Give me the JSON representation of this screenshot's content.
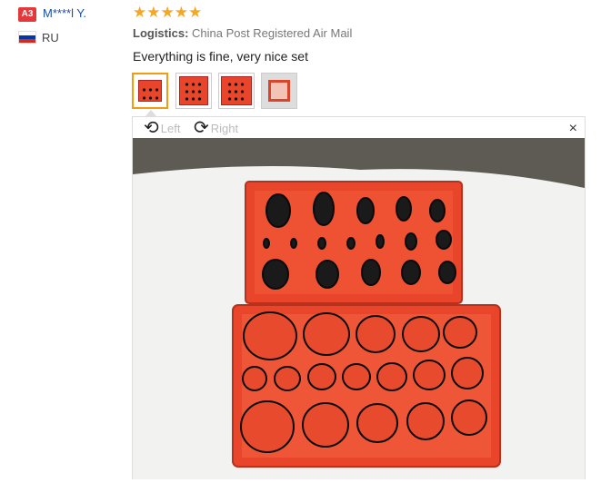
{
  "reviewer": {
    "badge": "A3",
    "name": "M****l Y.",
    "country": "RU",
    "flag_colors": [
      "#ffffff",
      "#0039a6",
      "#d52b1e"
    ]
  },
  "review": {
    "rating": 5,
    "stars": "★★★★★",
    "logistics_label": "Logistics:",
    "logistics_value": "China Post Registered Air Mail",
    "text": "Everything is fine, very nice set"
  },
  "thumbnails": [
    {
      "name": "photo-1",
      "active": true
    },
    {
      "name": "photo-2",
      "active": false
    },
    {
      "name": "photo-3",
      "active": false
    },
    {
      "name": "photo-4",
      "active": false
    }
  ],
  "viewer": {
    "rotate_left_label": "Left",
    "rotate_right_label": "Right",
    "close_symbol": "×",
    "rotate_left_icon": "⟲",
    "rotate_right_icon": "⟳"
  },
  "colors": {
    "accent_star": "#f5a623",
    "badge": "#e4393c",
    "case_red": "#e8452b",
    "link": "#1a4fa3"
  }
}
